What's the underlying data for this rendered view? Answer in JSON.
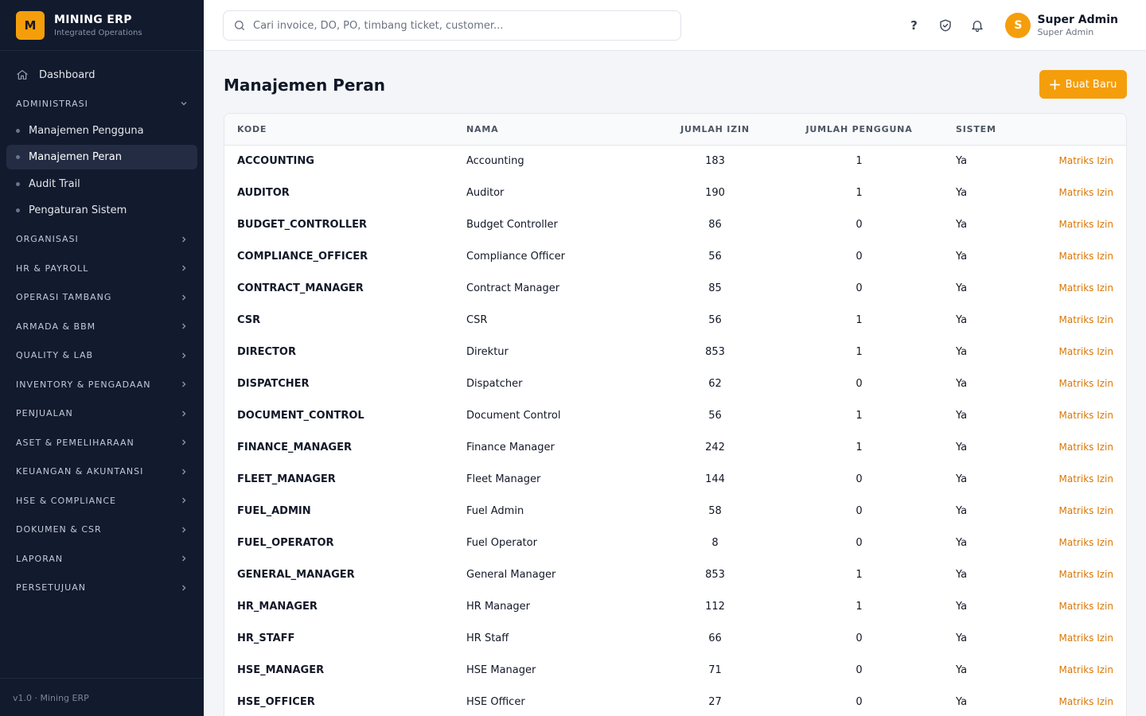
{
  "brand": {
    "logo_letter": "M",
    "title": "MINING ERP",
    "subtitle": "Integrated Operations",
    "accent": "#f59e0b"
  },
  "sidebar": {
    "dashboard": "Dashboard",
    "groups": [
      {
        "label": "ADMINISTRASI",
        "expanded": true
      },
      {
        "label": "ORGANISASI"
      },
      {
        "label": "HR & PAYROLL"
      },
      {
        "label": "OPERASI TAMBANG"
      },
      {
        "label": "ARMADA & BBM"
      },
      {
        "label": "QUALITY & LAB"
      },
      {
        "label": "INVENTORY & PENGADAAN"
      },
      {
        "label": "PENJUALAN"
      },
      {
        "label": "ASET & PEMELIHARAAN"
      },
      {
        "label": "KEUANGAN & AKUNTANSI"
      },
      {
        "label": "HSE & COMPLIANCE"
      },
      {
        "label": "DOKUMEN & CSR"
      },
      {
        "label": "LAPORAN"
      },
      {
        "label": "PERSETUJUAN"
      }
    ],
    "admin_items": [
      "Manajemen Pengguna",
      "Manajemen Peran",
      "Audit Trail",
      "Pengaturan Sistem"
    ],
    "active_item": "Manajemen Peran",
    "footer": "v1.0 · Mining ERP"
  },
  "topbar": {
    "search_placeholder": "Cari invoice, DO, PO, timbang ticket, customer...",
    "help": "?",
    "user": {
      "initial": "S",
      "name": "Super Admin",
      "role": "Super Admin"
    }
  },
  "page": {
    "title": "Manajemen Peran",
    "create_label": "Buat Baru"
  },
  "table": {
    "headers": {
      "code": "KODE",
      "name": "NAMA",
      "perms": "JUMLAH IZIN",
      "users": "JUMLAH PENGGUNA",
      "system": "SISTEM"
    },
    "action_label": "Matriks Izin",
    "rows": [
      {
        "code": "ACCOUNTING",
        "name": "Accounting",
        "perms": "183",
        "users": "1",
        "system": "Ya"
      },
      {
        "code": "AUDITOR",
        "name": "Auditor",
        "perms": "190",
        "users": "1",
        "system": "Ya"
      },
      {
        "code": "BUDGET_CONTROLLER",
        "name": "Budget Controller",
        "perms": "86",
        "users": "0",
        "system": "Ya"
      },
      {
        "code": "COMPLIANCE_OFFICER",
        "name": "Compliance Officer",
        "perms": "56",
        "users": "0",
        "system": "Ya"
      },
      {
        "code": "CONTRACT_MANAGER",
        "name": "Contract Manager",
        "perms": "85",
        "users": "0",
        "system": "Ya"
      },
      {
        "code": "CSR",
        "name": "CSR",
        "perms": "56",
        "users": "1",
        "system": "Ya"
      },
      {
        "code": "DIRECTOR",
        "name": "Direktur",
        "perms": "853",
        "users": "1",
        "system": "Ya"
      },
      {
        "code": "DISPATCHER",
        "name": "Dispatcher",
        "perms": "62",
        "users": "0",
        "system": "Ya"
      },
      {
        "code": "DOCUMENT_CONTROL",
        "name": "Document Control",
        "perms": "56",
        "users": "1",
        "system": "Ya"
      },
      {
        "code": "FINANCE_MANAGER",
        "name": "Finance Manager",
        "perms": "242",
        "users": "1",
        "system": "Ya"
      },
      {
        "code": "FLEET_MANAGER",
        "name": "Fleet Manager",
        "perms": "144",
        "users": "0",
        "system": "Ya"
      },
      {
        "code": "FUEL_ADMIN",
        "name": "Fuel Admin",
        "perms": "58",
        "users": "0",
        "system": "Ya"
      },
      {
        "code": "FUEL_OPERATOR",
        "name": "Fuel Operator",
        "perms": "8",
        "users": "0",
        "system": "Ya"
      },
      {
        "code": "GENERAL_MANAGER",
        "name": "General Manager",
        "perms": "853",
        "users": "1",
        "system": "Ya"
      },
      {
        "code": "HR_MANAGER",
        "name": "HR Manager",
        "perms": "112",
        "users": "1",
        "system": "Ya"
      },
      {
        "code": "HR_STAFF",
        "name": "HR Staff",
        "perms": "66",
        "users": "0",
        "system": "Ya"
      },
      {
        "code": "HSE_MANAGER",
        "name": "HSE Manager",
        "perms": "71",
        "users": "0",
        "system": "Ya"
      },
      {
        "code": "HSE_OFFICER",
        "name": "HSE Officer",
        "perms": "27",
        "users": "0",
        "system": "Ya"
      }
    ]
  }
}
